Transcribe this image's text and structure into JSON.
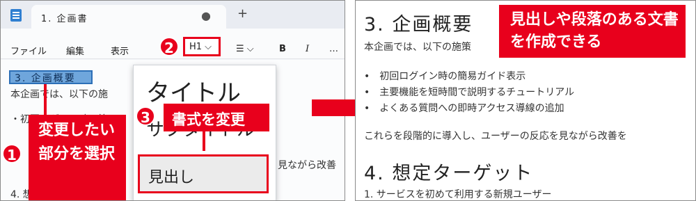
{
  "notepad": {
    "tab_title": "1. 企画書",
    "tab_modified_dot": "●",
    "new_tab": "+",
    "menu": {
      "file": "ファイル",
      "edit": "編集",
      "view": "表示"
    },
    "format_select": "H1 ⌵",
    "list_btn": "☰ ⌵",
    "bold_btn": "B",
    "italic_btn": "I",
    "more_btn": "…",
    "selected_text": "3. 企画概要",
    "doc_line_1": "本企画では、以下の施",
    "doc_line_2": "・初回ログイン時の簡",
    "doc_line_3": "4. 想",
    "doc_trailing": "見ながら改善",
    "dropdown": {
      "title": "タイトル",
      "subtitle": "サブタイトル",
      "heading": "見出し"
    }
  },
  "callouts": {
    "step1_num": "1",
    "step1_text": "変更したい部分を選択",
    "step2_num": "2",
    "step3_num": "3",
    "step3_text": "書式を変更",
    "right_text": "見出しや段落のある文書を作成できる"
  },
  "document": {
    "h1": "3. 企画概要",
    "intro": "本企画では、以下の施策",
    "bullets": [
      "初回ログイン時の簡易ガイド表示",
      "主要機能を短時間で説明するチュートリアル",
      "よくある質問への即時アクセス導線の追加"
    ],
    "paragraph": "これらを段階的に導入し、ユーザーの反応を見ながら改善を",
    "h2": "4. 想定ターゲット",
    "sub_item": "1. サービスを初めて利用する新規ユーザー"
  }
}
